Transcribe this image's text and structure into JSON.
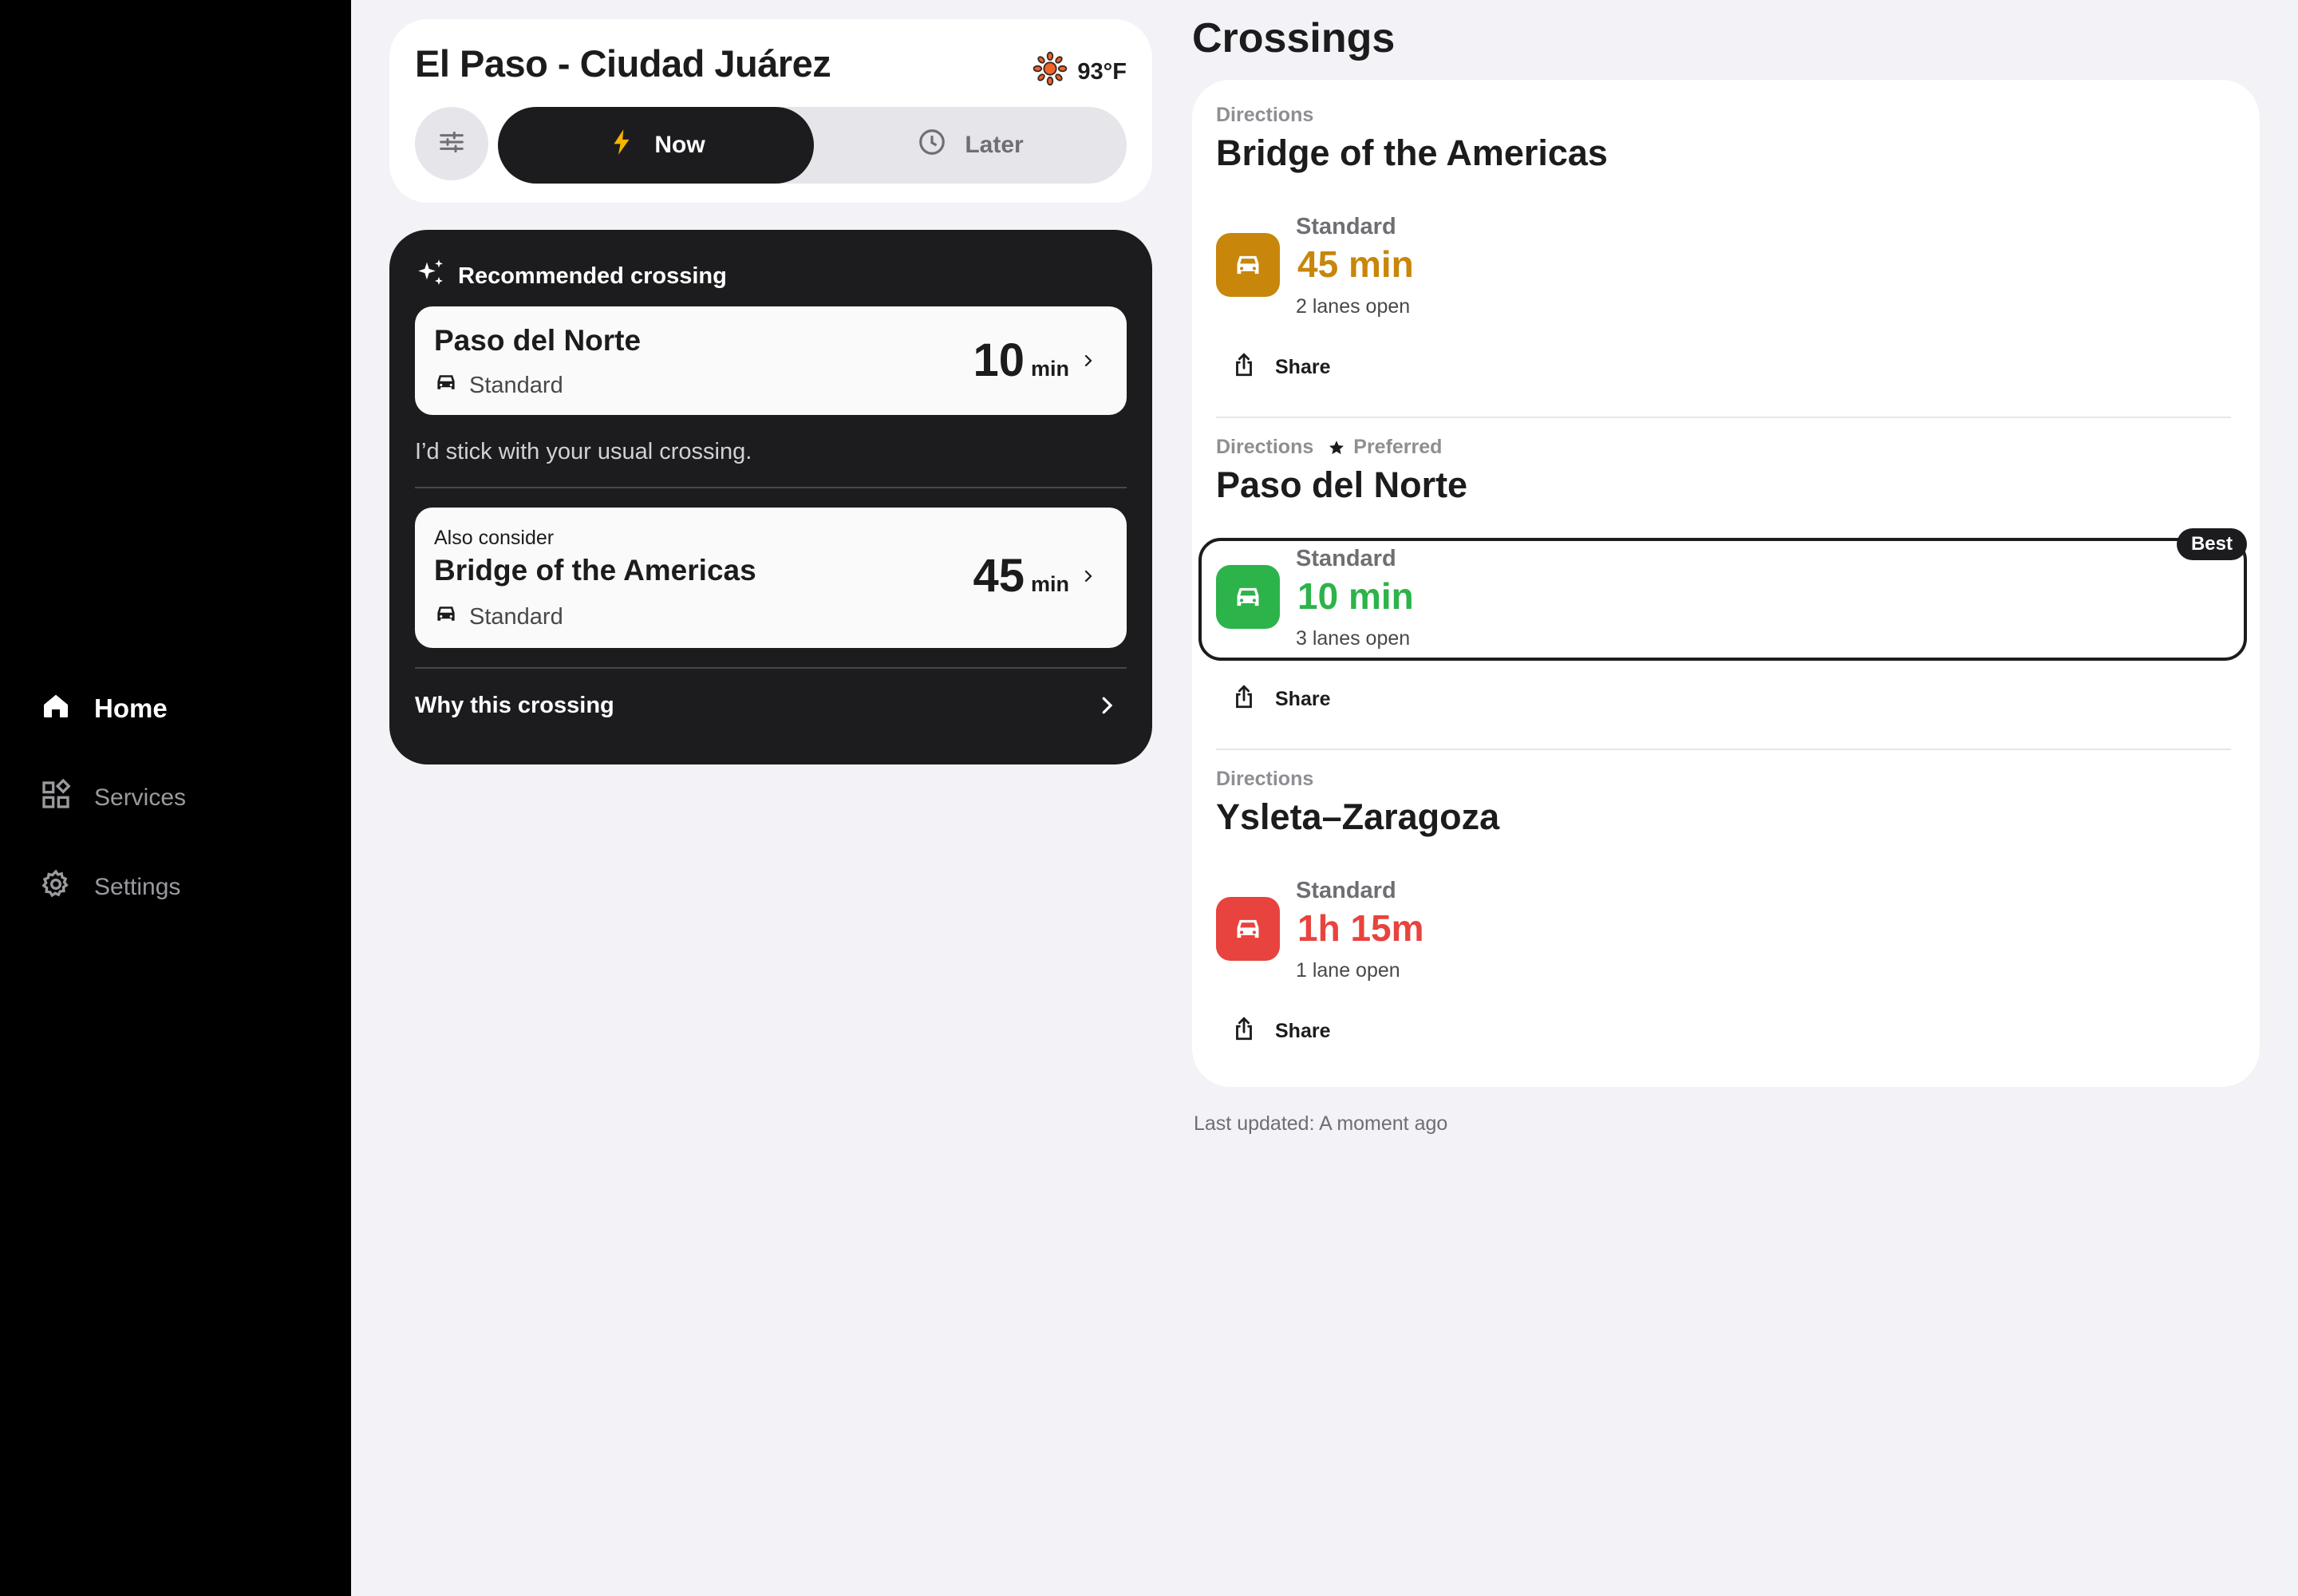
{
  "sidebar": {
    "items": [
      {
        "label": "Home",
        "icon": "home-icon",
        "active": true
      },
      {
        "label": "Services",
        "icon": "services-icon",
        "active": false
      },
      {
        "label": "Settings",
        "icon": "gear-icon",
        "active": false
      }
    ]
  },
  "location": {
    "title": "El Paso - Ciudad Juárez",
    "temperature": "93°F",
    "weather_icon": "sun-icon"
  },
  "mode": {
    "now_label": "Now",
    "later_label": "Later",
    "selected": "Now"
  },
  "recommendation": {
    "heading": "Recommended crossing",
    "primary": {
      "name": "Paso del Norte",
      "lane": "Standard",
      "time": "10",
      "unit": "min"
    },
    "message": "I’d stick with your usual crossing.",
    "alternative": {
      "caption": "Also consider",
      "name": "Bridge of the Americas",
      "lane": "Standard",
      "time": "45",
      "unit": "min"
    },
    "why_label": "Why this crossing"
  },
  "crossings": {
    "title": "Crossings",
    "items": [
      {
        "directions": "Directions",
        "preferred": "",
        "name": "Bridge of the Americas",
        "lane_type": "Standard",
        "time": "45 min",
        "lanes_open": "2 lanes open",
        "status_color": "#c8860a",
        "best": false,
        "share": "Share"
      },
      {
        "directions": "Directions",
        "preferred": "Preferred",
        "name": "Paso del Norte",
        "lane_type": "Standard",
        "time": "10 min",
        "lanes_open": "3 lanes open",
        "status_color": "#2cb34a",
        "best": true,
        "badge": "Best",
        "share": "Share"
      },
      {
        "directions": "Directions",
        "preferred": "",
        "name": "Ysleta–Zaragoza",
        "lane_type": "Standard",
        "time": "1h 15m",
        "lanes_open": "1 lane open",
        "status_color": "#e8433e",
        "best": false,
        "share": "Share"
      }
    ]
  },
  "last_updated": "Last updated: A moment ago",
  "colors": {
    "sidebar_bg": "#000000",
    "page_bg": "#f2f2f7",
    "dark_card": "#1c1c1e",
    "now_icon": "#f5b400",
    "sun": "#f0642a"
  }
}
